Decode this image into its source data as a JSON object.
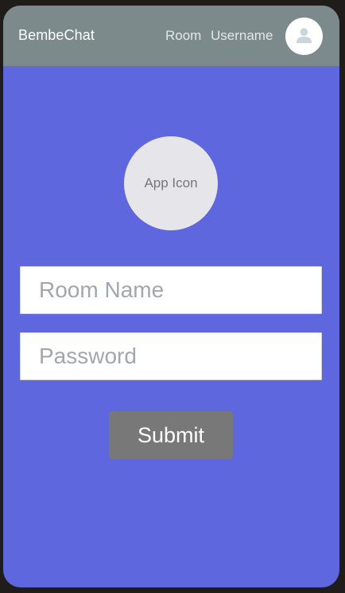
{
  "header": {
    "app_name": "BembeChat",
    "nav_room": "Room",
    "nav_username": "Username",
    "avatar_icon": "user-icon"
  },
  "main": {
    "app_icon_label": "App Icon",
    "room_name_placeholder": "Room Name",
    "room_name_value": "",
    "password_placeholder": "Password",
    "password_value": "",
    "submit_label": "Submit"
  },
  "colors": {
    "header_bg": "#7c8a8b",
    "page_bg": "#5e67dd",
    "button_bg": "#787878",
    "app_icon_bg": "#e6e6ea"
  }
}
